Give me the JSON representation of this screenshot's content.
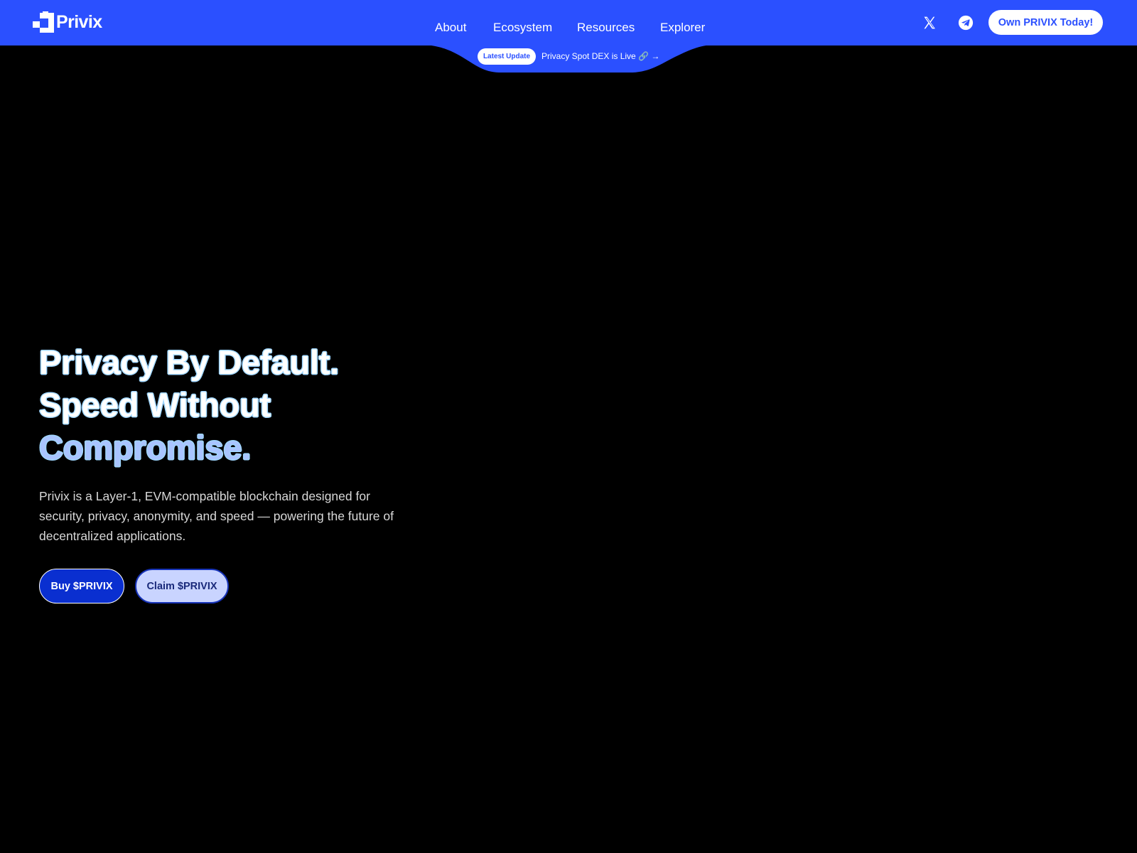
{
  "brand": {
    "name": "Privix",
    "color": "#2b50ff"
  },
  "nav": {
    "items": [
      {
        "label": "About"
      },
      {
        "label": "Ecosystem"
      },
      {
        "label": "Resources"
      },
      {
        "label": "Explorer"
      }
    ]
  },
  "header": {
    "social": [
      {
        "icon": "x-twitter-icon"
      },
      {
        "icon": "telegram-icon"
      }
    ],
    "cta_label": "Own PRIVIX Today!"
  },
  "update": {
    "badge": "Latest Update",
    "text": "Privacy Spot DEX is Live 🔗 →"
  },
  "hero": {
    "title_lines": [
      "Privacy By Default.",
      "Speed Without",
      "Compromise."
    ],
    "description": "Privix is a Layer-1, EVM-compatible blockchain designed for security, privacy, anonymity, and speed — powering the future of decentralized applications.",
    "buy_label": "Buy $PRIVIX",
    "claim_label": "Claim $PRIVIX"
  },
  "colors": {
    "header_bg": "#2b50ff",
    "page_bg": "#000000",
    "buy_bg": "#0a2fd0",
    "claim_bg": "#c9d4ff",
    "title_accent": "#a9c4ff"
  }
}
